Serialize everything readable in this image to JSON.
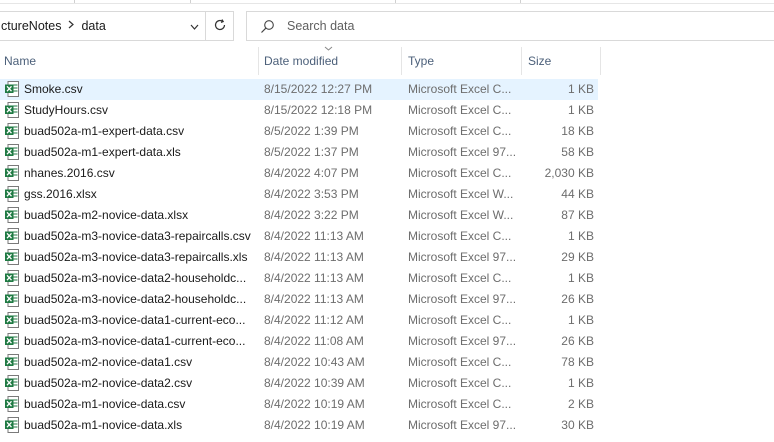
{
  "breadcrumb": {
    "items": [
      "ctureNotes",
      "data"
    ]
  },
  "search": {
    "placeholder": "Search data"
  },
  "columns": {
    "name": "Name",
    "date": "Date modified",
    "type": "Type",
    "size": "Size"
  },
  "icons": {
    "breadcrumb_separator": "chevron-right-icon",
    "address_dropdown": "chevron-down-icon",
    "refresh": "refresh-icon",
    "search": "search-icon",
    "file": "excel-file-icon"
  },
  "colors": {
    "selected_row": "#e5f3ff",
    "excel_green": "#1f7a43",
    "header_text": "#4c607a"
  },
  "files": [
    {
      "name": "Smoke.csv",
      "date": "8/15/2022 12:27 PM",
      "type": "Microsoft Excel C...",
      "size": "1 KB",
      "selected": true
    },
    {
      "name": "StudyHours.csv",
      "date": "8/15/2022 12:18 PM",
      "type": "Microsoft Excel C...",
      "size": "1 KB"
    },
    {
      "name": "buad502a-m1-expert-data.csv",
      "date": "8/5/2022 1:39 PM",
      "type": "Microsoft Excel C...",
      "size": "18 KB"
    },
    {
      "name": "buad502a-m1-expert-data.xls",
      "date": "8/5/2022 1:37 PM",
      "type": "Microsoft Excel 97...",
      "size": "58 KB"
    },
    {
      "name": "nhanes.2016.csv",
      "date": "8/4/2022 4:07 PM",
      "type": "Microsoft Excel C...",
      "size": "2,030 KB"
    },
    {
      "name": "gss.2016.xlsx",
      "date": "8/4/2022 3:53 PM",
      "type": "Microsoft Excel W...",
      "size": "44 KB"
    },
    {
      "name": "buad502a-m2-novice-data.xlsx",
      "date": "8/4/2022 3:22 PM",
      "type": "Microsoft Excel W...",
      "size": "87 KB"
    },
    {
      "name": "buad502a-m3-novice-data3-repaircalls.csv",
      "date": "8/4/2022 11:13 AM",
      "type": "Microsoft Excel C...",
      "size": "1 KB"
    },
    {
      "name": "buad502a-m3-novice-data3-repaircalls.xls",
      "date": "8/4/2022 11:13 AM",
      "type": "Microsoft Excel 97...",
      "size": "29 KB"
    },
    {
      "name": "buad502a-m3-novice-data2-householdc...",
      "date": "8/4/2022 11:13 AM",
      "type": "Microsoft Excel C...",
      "size": "1 KB"
    },
    {
      "name": "buad502a-m3-novice-data2-householdc...",
      "date": "8/4/2022 11:13 AM",
      "type": "Microsoft Excel 97...",
      "size": "26 KB"
    },
    {
      "name": "buad502a-m3-novice-data1-current-eco...",
      "date": "8/4/2022 11:12 AM",
      "type": "Microsoft Excel C...",
      "size": "1 KB"
    },
    {
      "name": "buad502a-m3-novice-data1-current-eco...",
      "date": "8/4/2022 11:08 AM",
      "type": "Microsoft Excel 97...",
      "size": "26 KB"
    },
    {
      "name": "buad502a-m2-novice-data1.csv",
      "date": "8/4/2022 10:43 AM",
      "type": "Microsoft Excel C...",
      "size": "78 KB"
    },
    {
      "name": "buad502a-m2-novice-data2.csv",
      "date": "8/4/2022 10:39 AM",
      "type": "Microsoft Excel C...",
      "size": "1 KB"
    },
    {
      "name": "buad502a-m1-novice-data.csv",
      "date": "8/4/2022 10:19 AM",
      "type": "Microsoft Excel C...",
      "size": "2 KB"
    },
    {
      "name": "buad502a-m1-novice-data.xls",
      "date": "8/4/2022 10:19 AM",
      "type": "Microsoft Excel 97...",
      "size": "30 KB"
    }
  ]
}
